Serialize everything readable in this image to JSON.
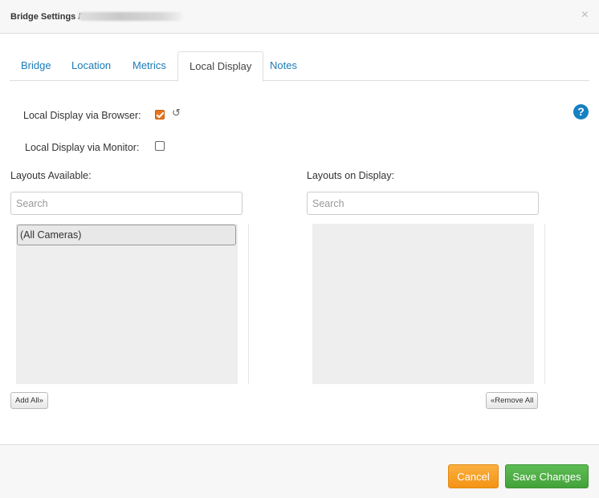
{
  "header": {
    "title": "Bridge Settings //",
    "close_symbol": "×"
  },
  "tabs": [
    {
      "label": "Bridge"
    },
    {
      "label": "Location"
    },
    {
      "label": "Metrics"
    },
    {
      "label": "Local Display",
      "active": true
    },
    {
      "label": "Notes"
    }
  ],
  "options": {
    "browser_label": "Local Display via Browser:",
    "browser_checked": true,
    "monitor_label": "Local Display via Monitor:",
    "monitor_checked": false,
    "undo_symbol": "↺",
    "help_symbol": "?"
  },
  "available": {
    "heading": "Layouts Available:",
    "search_placeholder": "Search",
    "items": [
      "(All Cameras)"
    ],
    "add_all_label": "Add All»"
  },
  "on_display": {
    "heading": "Layouts on Display:",
    "search_placeholder": "Search",
    "items": [],
    "remove_all_label": "«Remove All"
  },
  "footer": {
    "cancel_label": "Cancel",
    "save_label": "Save Changes"
  },
  "colors": {
    "accent_link": "#1a7bb9",
    "checkbox_orange": "#e8741e",
    "cancel_orange": "#f39415",
    "save_green": "#43a23a",
    "help_blue": "#1580c2"
  }
}
